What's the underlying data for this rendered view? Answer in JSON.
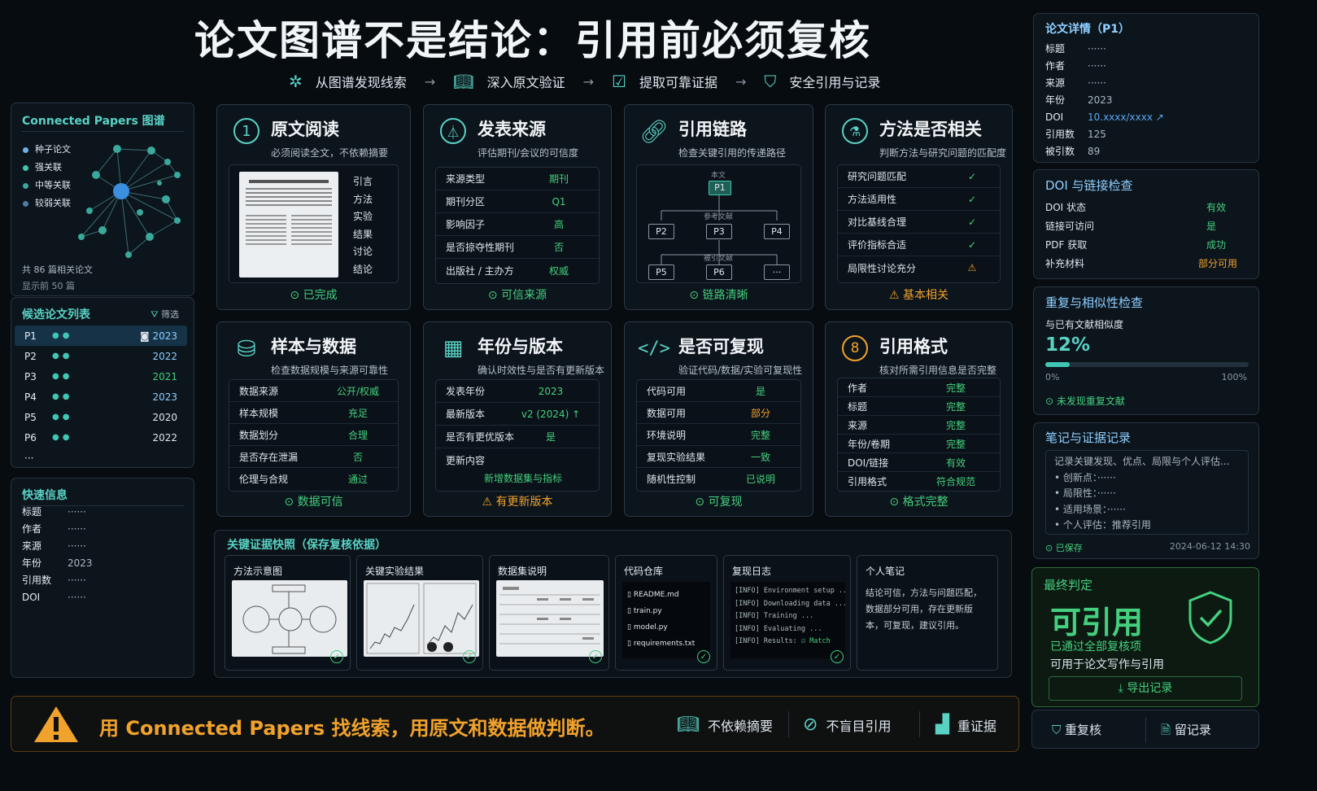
{
  "header": {
    "title": "论文图谱不是结论：引用前必须复核",
    "flow": [
      "从图谱发现线索",
      "深入原文验证",
      "提取可靠证据",
      "安全引用与记录"
    ]
  },
  "graph_panel": {
    "title": "Connected Papers 图谱",
    "legend": [
      "种子论文",
      "强关联",
      "中等关联",
      "较弱关联"
    ],
    "total": "共 86 篇相关论文",
    "shown": "显示前 50 篇"
  },
  "candidates": {
    "title": "候选论文列表",
    "filter": "筛选",
    "rows": [
      {
        "id": "P1",
        "year": "2023"
      },
      {
        "id": "P2",
        "year": "2022"
      },
      {
        "id": "P3",
        "year": "2021"
      },
      {
        "id": "P4",
        "year": "2023"
      },
      {
        "id": "P5",
        "year": "2020"
      },
      {
        "id": "P6",
        "year": "2022"
      }
    ],
    "more": "···"
  },
  "quick": {
    "title": "快速信息",
    "items": [
      {
        "k": "标题",
        "v": "······"
      },
      {
        "k": "作者",
        "v": "······"
      },
      {
        "k": "来源",
        "v": "······"
      },
      {
        "k": "年份",
        "v": "2023"
      },
      {
        "k": "引用数",
        "v": "······"
      },
      {
        "k": "DOI",
        "v": "······"
      }
    ]
  },
  "cards": {
    "c1": {
      "title": "原文阅读",
      "sub": "必须阅读全文，不依赖摘要",
      "num": "1",
      "sections": [
        "引言",
        "方法",
        "实验",
        "结果",
        "讨论",
        "结论"
      ],
      "foot": "已完成"
    },
    "c2": {
      "title": "发表来源",
      "sub": "评估期刊/会议的可信度",
      "rows": [
        {
          "k": "来源类型",
          "v": "期刊"
        },
        {
          "k": "期刊分区",
          "v": "Q1"
        },
        {
          "k": "影响因子",
          "v": "高"
        },
        {
          "k": "是否掠夺性期刊",
          "v": "否"
        },
        {
          "k": "出版社 / 主办方",
          "v": "权威"
        }
      ],
      "foot": "可信来源"
    },
    "c3": {
      "title": "引用链路",
      "sub": "检查关键引用的传递路径",
      "main_label": "本文",
      "main": "P1",
      "ref_label": "参考文献",
      "cited_label": "被引文献",
      "refs": [
        "P2",
        "P3",
        "P4"
      ],
      "cited": [
        "P5",
        "P6",
        "···"
      ],
      "foot": "链路清晰"
    },
    "c4": {
      "title": "方法是否相关",
      "sub": "判断方法与研究问题的匹配度",
      "rows": [
        {
          "k": "研究问题匹配",
          "v": "✓"
        },
        {
          "k": "方法适用性",
          "v": "✓"
        },
        {
          "k": "对比基线合理",
          "v": "✓"
        },
        {
          "k": "评价指标合适",
          "v": "✓"
        },
        {
          "k": "局限性讨论充分",
          "v": "⚠"
        }
      ],
      "foot": "基本相关"
    },
    "c5": {
      "title": "样本与数据",
      "sub": "检查数据规模与来源可靠性",
      "rows": [
        {
          "k": "数据来源",
          "v": "公开/权威"
        },
        {
          "k": "样本规模",
          "v": "充足"
        },
        {
          "k": "数据划分",
          "v": "合理"
        },
        {
          "k": "是否存在泄漏",
          "v": "否"
        },
        {
          "k": "伦理与合规",
          "v": "通过"
        }
      ],
      "foot": "数据可信"
    },
    "c6": {
      "title": "年份与版本",
      "sub": "确认时效性与是否有更新版本",
      "rows": [
        {
          "k": "发表年份",
          "v": "2023"
        },
        {
          "k": "最新版本",
          "v": "v2 (2024) ↑"
        },
        {
          "k": "是否有更优版本",
          "v": "是"
        },
        {
          "k": "更新内容",
          "v": ""
        }
      ],
      "update": "新增数据集与指标",
      "foot": "有更新版本"
    },
    "c7": {
      "title": "是否可复现",
      "sub": "验证代码/数据/实验可复现性",
      "rows": [
        {
          "k": "代码可用",
          "v": "是"
        },
        {
          "k": "数据可用",
          "v": "部分"
        },
        {
          "k": "环境说明",
          "v": "完整"
        },
        {
          "k": "复现实验结果",
          "v": "一致"
        },
        {
          "k": "随机性控制",
          "v": "已说明"
        }
      ],
      "foot": "可复现"
    },
    "c8": {
      "title": "引用格式",
      "sub": "核对所需引用信息是否完整",
      "num": "8",
      "rows": [
        {
          "k": "作者",
          "v": "完整"
        },
        {
          "k": "标题",
          "v": "完整"
        },
        {
          "k": "来源",
          "v": "完整"
        },
        {
          "k": "年份/卷期",
          "v": "完整"
        },
        {
          "k": "DOI/链接",
          "v": "有效"
        },
        {
          "k": "引用格式",
          "v": "符合规范"
        }
      ],
      "foot": "格式完整"
    }
  },
  "evidence": {
    "title": "关键证据快照（保存复核依据）",
    "items": [
      "方法示意图",
      "关键实验结果",
      "数据集说明",
      "代码仓库",
      "复现日志",
      "个人笔记"
    ],
    "files": [
      "README.md",
      "train.py",
      "model.py",
      "requirements.txt"
    ],
    "log": [
      "[INFO] Environment setup ...",
      "[INFO] Downloading data ...",
      "[INFO] Training ...",
      "[INFO] Evaluating ...",
      "[INFO] Results:"
    ],
    "log_match": "Match",
    "note": "结论可信，方法与问题匹配，数据部分可用，存在更新版本，可复现，建议引用。"
  },
  "detail": {
    "title": "论文详情（P1）",
    "items": [
      {
        "k": "标题",
        "v": "······"
      },
      {
        "k": "作者",
        "v": "······"
      },
      {
        "k": "来源",
        "v": "······"
      },
      {
        "k": "年份",
        "v": "2023"
      },
      {
        "k": "DOI",
        "v": "10.xxxx/xxxx"
      },
      {
        "k": "引用数",
        "v": "125"
      },
      {
        "k": "被引数",
        "v": "89"
      }
    ]
  },
  "doi": {
    "title": "DOI 与链接检查",
    "rows": [
      {
        "k": "DOI 状态",
        "v": "有效"
      },
      {
        "k": "链接可访问",
        "v": "是"
      },
      {
        "k": "PDF 获取",
        "v": "成功"
      },
      {
        "k": "补充材料",
        "v": "部分可用"
      }
    ]
  },
  "dup": {
    "title": "重复与相似性检查",
    "label": "与已有文献相似度",
    "value": "12%",
    "fraction": 0.12,
    "min": "0%",
    "max": "100%",
    "status": "未发现重复文献"
  },
  "notes": {
    "title": "笔记与证据记录",
    "intro": "记录关键发现、优点、局限与个人评估...",
    "bullets": [
      "创新点：······",
      "局限性：······",
      "适用场景：······",
      "个人评估：推荐引用"
    ],
    "saved": "已保存",
    "time": "2024-06-12 14:30"
  },
  "verdict": {
    "title": "最终判定",
    "big": "可引用",
    "line1": "已通过全部复核项",
    "line2": "可用于论文写作与引用",
    "export": "导出记录"
  },
  "bottom_actions": [
    "重复核",
    "留记录"
  ],
  "footer": {
    "message": "用 Connected Papers 找线索，用原文和数据做判断。",
    "items": [
      "不依赖摘要",
      "不盲目引用",
      "重证据"
    ]
  },
  "colors": {
    "accent": "#59d2c4",
    "ok": "#44d07e",
    "warn": "#f1a22c",
    "bg": "#070c11"
  }
}
